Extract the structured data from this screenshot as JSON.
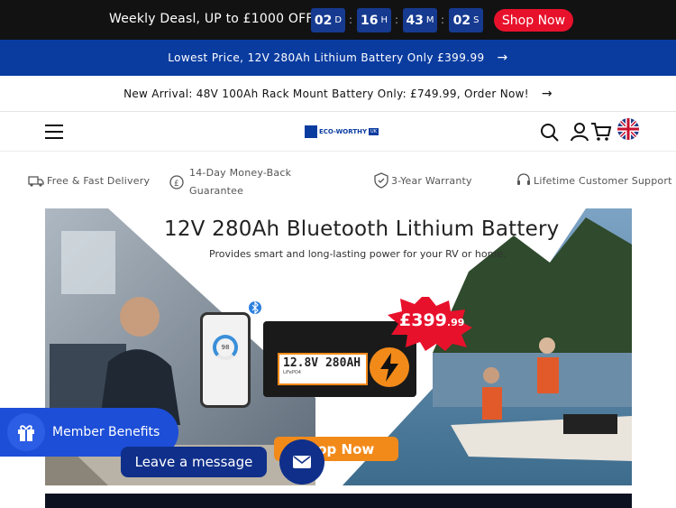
{
  "announcement": {
    "promo_text": "Weekly Deasl, UP to £1000 OFF",
    "countdown": [
      {
        "value": "02",
        "unit": "D"
      },
      {
        "value": "16",
        "unit": "H"
      },
      {
        "value": "43",
        "unit": "M"
      },
      {
        "value": "02",
        "unit": "S"
      }
    ],
    "shop_now": "Shop Now"
  },
  "blue_banner": {
    "text": "Lowest Price, 12V 280Ah Lithium Battery Only £399.99"
  },
  "white_banner": {
    "text": "New Arrival: 48V 100Ah Rack Mount Battery Only: £749.99, Order Now!"
  },
  "header": {
    "logo_text": "ECO-WORTHY",
    "logo_badge": "UK",
    "icons": [
      "menu-icon",
      "search-icon",
      "account-icon",
      "cart-icon",
      "uk-flag-icon"
    ]
  },
  "features": [
    {
      "icon": "delivery-truck-icon",
      "label": "Free & Fast Delivery"
    },
    {
      "icon": "money-back-icon",
      "label_line1": "14-Day Money-Back",
      "label_line2": "Guarantee"
    },
    {
      "icon": "warranty-shield-icon",
      "label": "3-Year Warranty"
    },
    {
      "icon": "headset-icon",
      "label": "Lifetime Customer Support"
    }
  ],
  "hero": {
    "title": "12V 280Ah Bluetooth Lithium Battery",
    "subtitle": "Provides smart and long-lasting power for your RV or home.",
    "price_main": "£399",
    "price_cents": ".99",
    "battery_label_line1": "12.8V 280AH",
    "battery_label_line2": "LiFePO4",
    "app_gauge_value": "98",
    "button_label": "Shop Now"
  },
  "floating": {
    "member_benefits": "Member Benefits",
    "leave_message": "Leave a message"
  },
  "colors": {
    "topbar_bg": "#121212",
    "countdown_bg": "#163a90",
    "shop_now_bg": "#e8112b",
    "brand_blue": "#0a3ca0",
    "accent_orange": "#f28a1a"
  }
}
